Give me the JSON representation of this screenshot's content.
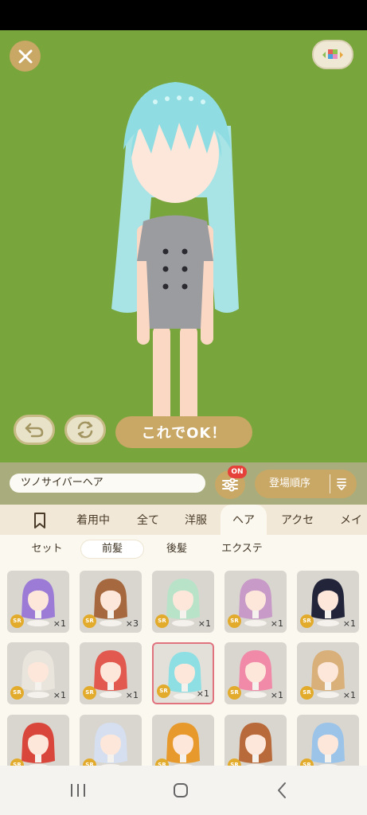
{
  "colors": {
    "stage": "#78a63c",
    "accent": "#c9a765",
    "badge": "#e5413a",
    "sr": "#e3ab2b",
    "selected": "#e1737f"
  },
  "stage": {
    "close_icon": "close-icon",
    "layout_icon": "color-grid-icon",
    "undo_icon": "undo-icon",
    "rotate_icon": "rotate-icon",
    "ok_label": "これでOK！"
  },
  "search": {
    "current_item": "ツノサイバーヘア",
    "filter_badge": "ON",
    "sort_label": "登場順序"
  },
  "category_tabs": [
    "着用中",
    "全て",
    "洋服",
    "ヘア",
    "アクセ",
    "メイク"
  ],
  "active_category": "ヘア",
  "sub_tabs": [
    "セット",
    "前髪",
    "後髪",
    "エクステ"
  ],
  "active_sub_tab": "前髪",
  "items": [
    {
      "rarity": "SR",
      "qty": "×1",
      "hair": "#9b7bd6"
    },
    {
      "rarity": "SR",
      "qty": "×3",
      "hair": "#a5683f"
    },
    {
      "rarity": "SR",
      "qty": "×1",
      "hair": "#b9e3c9"
    },
    {
      "rarity": "SR",
      "qty": "×1",
      "hair": "#c79ac7"
    },
    {
      "rarity": "SR",
      "qty": "×1",
      "hair": "#22253a"
    },
    {
      "rarity": "SR",
      "qty": "×1",
      "hair": "#e9e4dc"
    },
    {
      "rarity": "SR",
      "qty": "×1",
      "hair": "#e25a4f"
    },
    {
      "rarity": "SR",
      "qty": "×1",
      "hair": "#8edfe3",
      "selected": true
    },
    {
      "rarity": "SR",
      "qty": "×1",
      "hair": "#f08aa8"
    },
    {
      "rarity": "SR",
      "qty": "×1",
      "hair": "#d9b07a"
    },
    {
      "rarity": "SR",
      "qty": "",
      "hair": "#d9473c"
    },
    {
      "rarity": "SR",
      "qty": "",
      "hair": "#d5dff0"
    },
    {
      "rarity": "SR",
      "qty": "",
      "hair": "#e79a2b"
    },
    {
      "rarity": "SR",
      "qty": "",
      "hair": "#b86a3a"
    },
    {
      "rarity": "SR",
      "qty": "",
      "hair": "#9cc3e8"
    }
  ],
  "navbar": {
    "recent_icon": "recent-apps-icon",
    "home_icon": "home-icon",
    "back_icon": "back-icon"
  }
}
